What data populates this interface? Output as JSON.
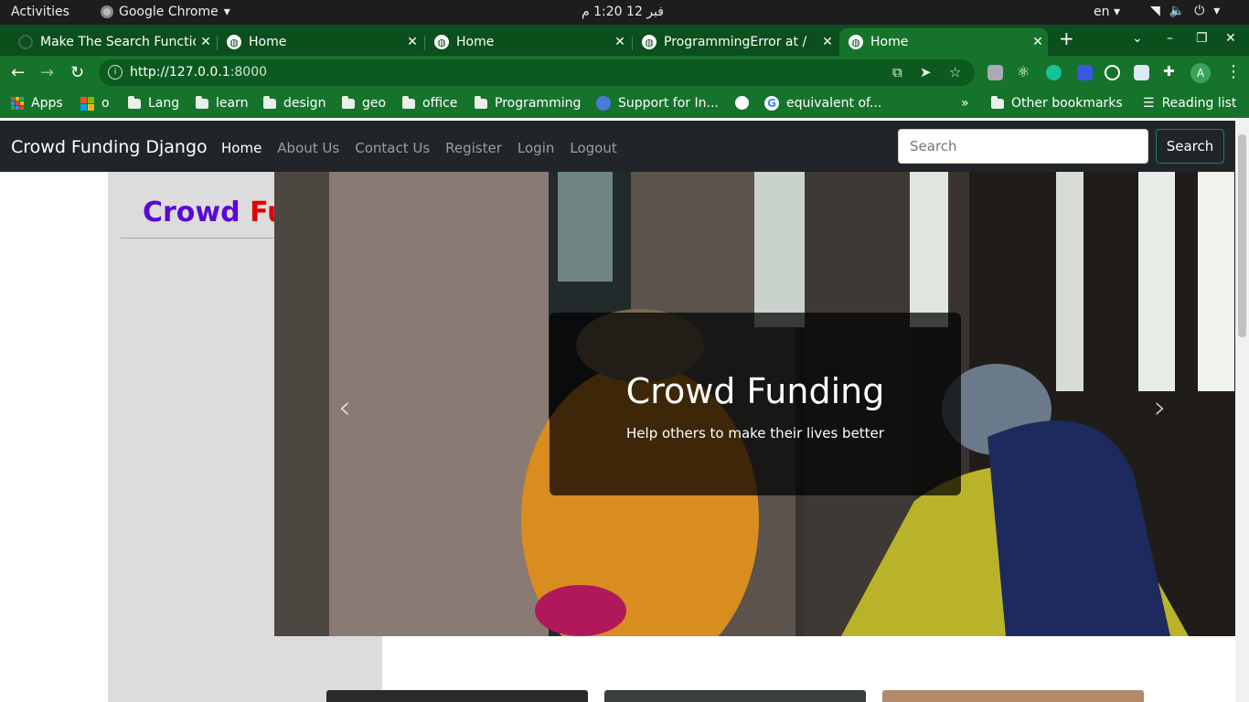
{
  "system_bar": {
    "activities": "Activities",
    "app_name": "Google Chrome",
    "clock": "فبر 12  1:20 م",
    "language": "en"
  },
  "tabs": [
    {
      "title": "Make The Search Functio",
      "active": false
    },
    {
      "title": "Home",
      "active": false
    },
    {
      "title": "Home",
      "active": false
    },
    {
      "title": "ProgrammingError at /",
      "active": false
    },
    {
      "title": "Home",
      "active": true
    }
  ],
  "toolbar": {
    "url_host": "http://127.0.0.1",
    "url_port": ":8000"
  },
  "bookmarks": {
    "apps": "Apps",
    "items": [
      "o",
      "Lang",
      "learn",
      "design",
      "geo",
      "office",
      "Programming",
      "Support for In...",
      "",
      "equivalent of..."
    ],
    "overflow": "»",
    "other": "Other bookmarks",
    "reading_list": "Reading list"
  },
  "site": {
    "brand": "Crowd Funding Django",
    "nav": [
      "Home",
      "About Us",
      "Contact Us",
      "Register",
      "Login",
      "Logout"
    ],
    "search_placeholder": "Search",
    "search_button": "Search",
    "heading_word1": "Crowd",
    "heading_word2": "Fu",
    "carousel": {
      "title": "Crowd Funding",
      "subtitle": "Help others to make their lives better"
    }
  }
}
